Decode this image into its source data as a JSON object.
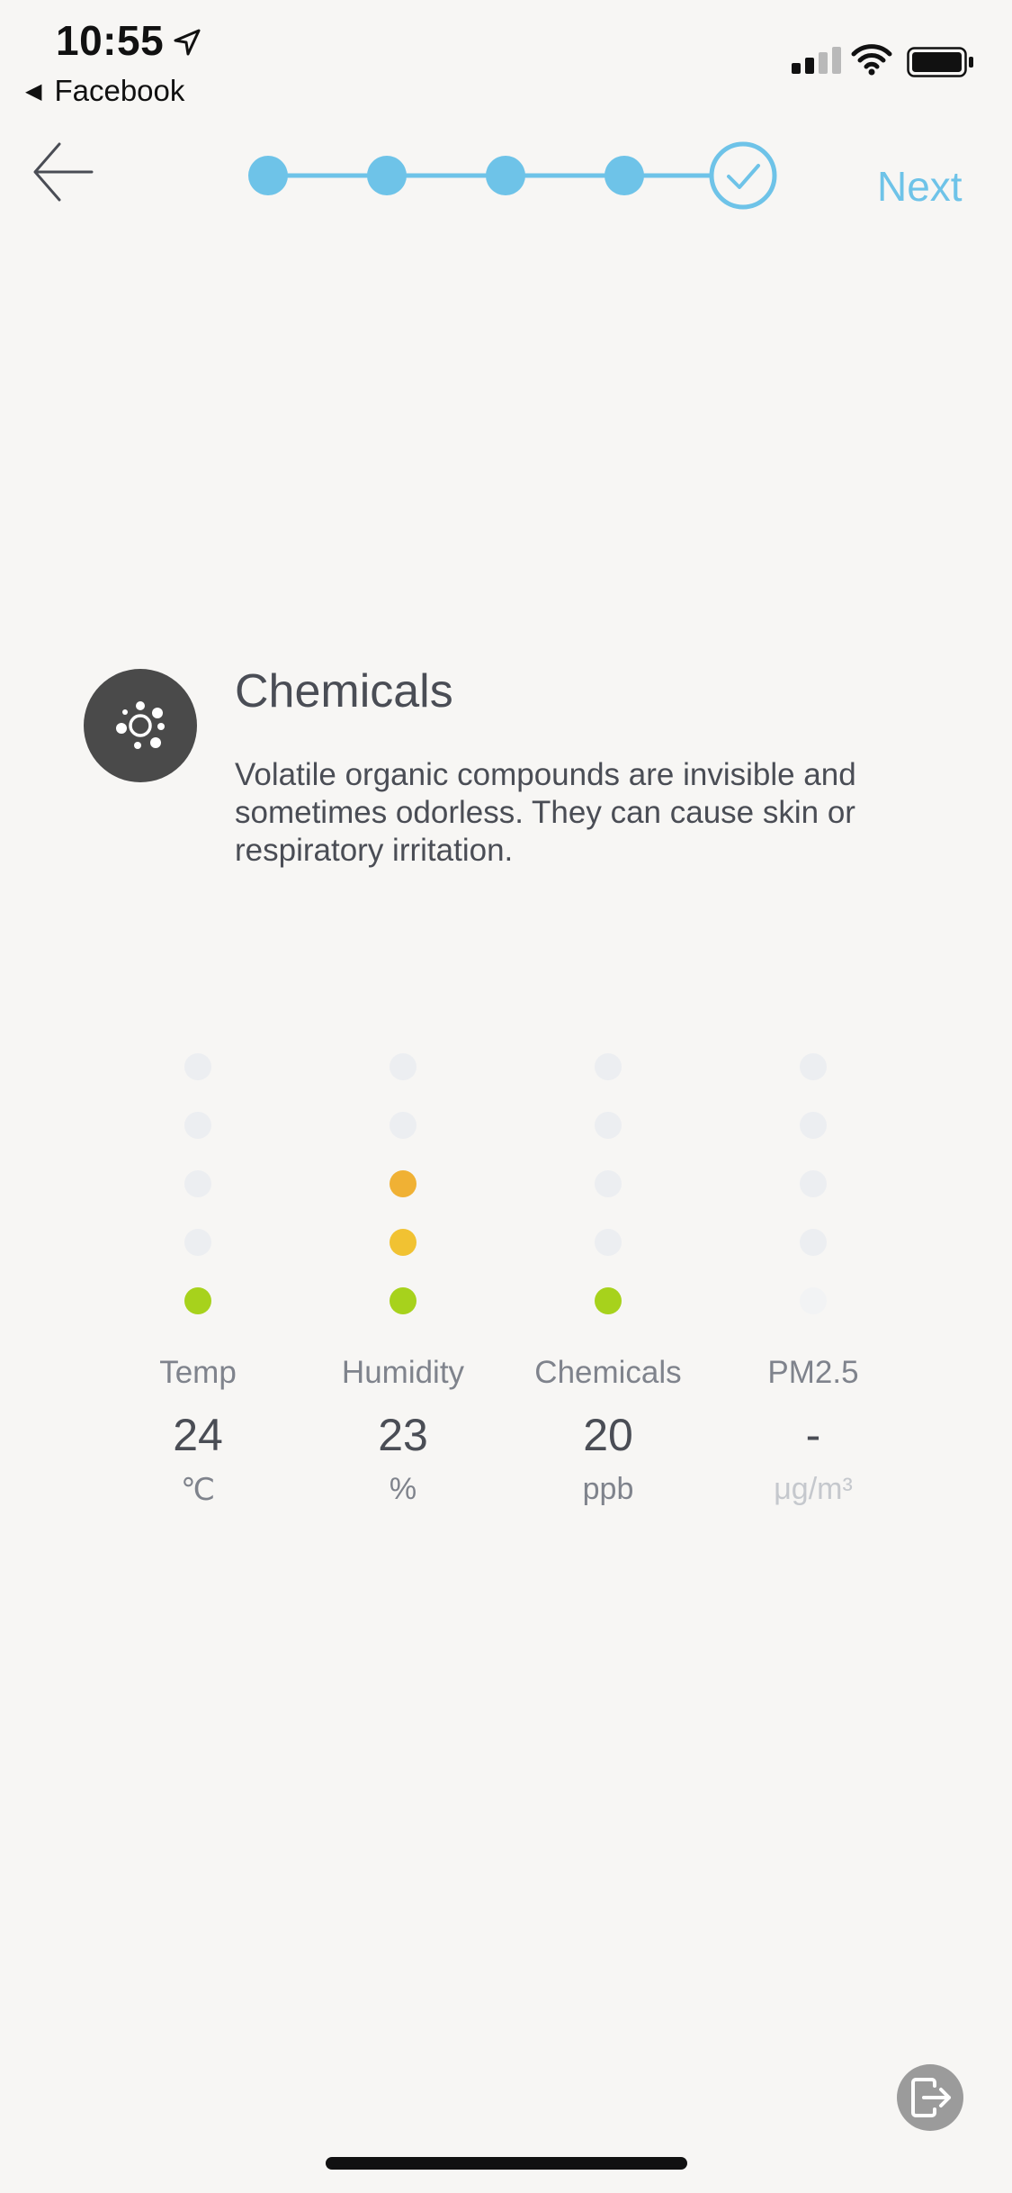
{
  "status_bar": {
    "time": "10:55",
    "back_app_label": "Facebook"
  },
  "nav": {
    "next_label": "Next",
    "steps_total": 5,
    "steps_completed": 5,
    "accent_color": "#6ec3e8"
  },
  "info": {
    "icon": "chemicals-icon",
    "title": "Chemicals",
    "description": "Volatile organic compounds are invisible and sometimes odorless. They can cause skin or respiratory irritation."
  },
  "metrics": [
    {
      "label": "Temp",
      "value": "24",
      "unit": "℃",
      "level": 1,
      "level_colors": [
        "#a7d21c"
      ]
    },
    {
      "label": "Humidity",
      "value": "23",
      "unit": "%",
      "level": 3,
      "level_colors": [
        "#a7d21c",
        "#f1c232",
        "#f0b134"
      ]
    },
    {
      "label": "Chemicals",
      "value": "20",
      "unit": "ppb",
      "level": 1,
      "level_colors": [
        "#a7d21c"
      ]
    },
    {
      "label": "PM2.5",
      "value": "-",
      "unit": "μg/m³",
      "level": 0,
      "level_colors": []
    }
  ],
  "colors": {
    "background": "#f7f6f4",
    "accent": "#6ec3e8",
    "inactive_dot": "#eceef1",
    "good": "#a7d21c",
    "moderate": "#f1c232"
  },
  "actions": {
    "exit_icon": "exit-icon"
  }
}
